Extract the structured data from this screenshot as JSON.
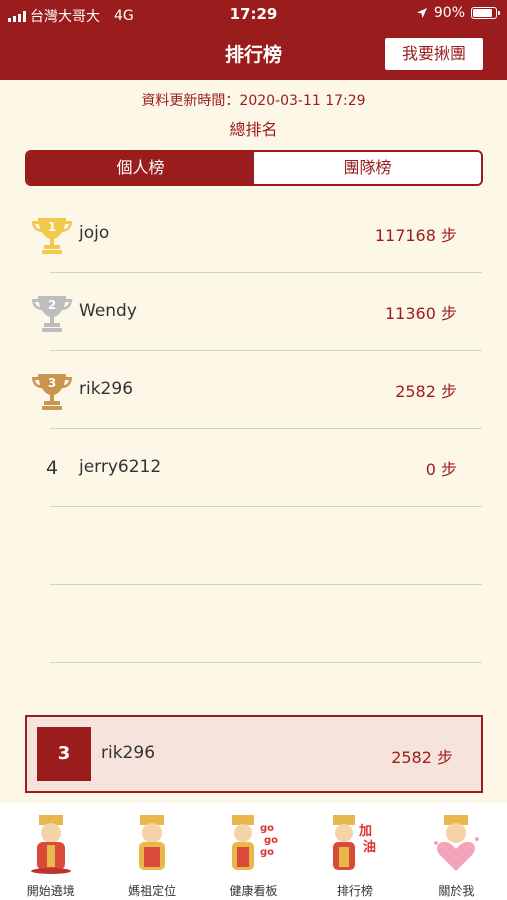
{
  "status_bar": {
    "carrier": "台灣大哥大",
    "network": "4G",
    "time": "17:29",
    "battery": "90%"
  },
  "header": {
    "title": "排行榜",
    "team_button": "我要揪團"
  },
  "update_text": "資料更新時間：2020-03-11 17:29",
  "subtitle": "總排名",
  "tabs": [
    {
      "label": "個人榜",
      "active": true
    },
    {
      "label": "團隊榜",
      "active": false
    }
  ],
  "ranking": [
    {
      "rank": "1",
      "name": "jojo",
      "steps": "117168 步",
      "icon": "gold-trophy-icon"
    },
    {
      "rank": "2",
      "name": "Wendy",
      "steps": "11360 步",
      "icon": "silver-trophy-icon"
    },
    {
      "rank": "3",
      "name": "rik296",
      "steps": "2582 步",
      "icon": "bronze-trophy-icon"
    },
    {
      "rank": "4",
      "name": "jerry6212",
      "steps": "0 步"
    }
  ],
  "my_rank": {
    "rank": "3",
    "name": "rik296",
    "steps": "2582 步"
  },
  "tabbar": [
    {
      "label": "開始遶境",
      "icon": "mazu-start-icon"
    },
    {
      "label": "媽祖定位",
      "icon": "mazu-location-icon"
    },
    {
      "label": "健康看板",
      "icon": "mazu-gogo-icon",
      "text": "go go go go"
    },
    {
      "label": "排行榜",
      "icon": "mazu-cheer-icon",
      "text": "加油"
    },
    {
      "label": "關於我",
      "icon": "mazu-heart-icon"
    }
  ],
  "colors": {
    "primary": "#9b1c1c",
    "background": "#fdf7e8",
    "gold": "#f2c94c",
    "silver": "#bdbdbd",
    "bronze": "#c9954f"
  }
}
